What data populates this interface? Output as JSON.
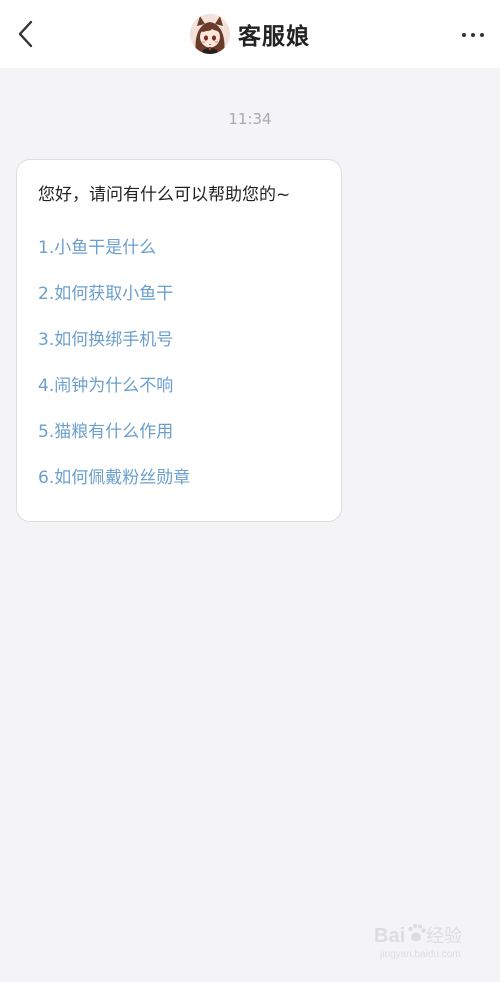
{
  "header": {
    "title": "客服娘",
    "back_icon": "chevron-left-icon",
    "more_icon": "more-horizontal-icon",
    "avatar": "avatar-anime-girl"
  },
  "chat": {
    "timestamp": "11:34",
    "message": {
      "greeting": "您好，请问有什么可以帮助您的~",
      "options": [
        "1.小鱼干是什么",
        "2.如何获取小鱼干",
        "3.如何换绑手机号",
        "4.闹钟为什么不响",
        "5.猫粮有什么作用",
        "6.如何佩戴粉丝勋章"
      ]
    }
  },
  "watermark": {
    "brand": "Baidu经验",
    "url": "jingyan.baidu.com"
  },
  "colors": {
    "background": "#f4f4f6",
    "header_bg": "#ffffff",
    "bubble_bg": "#ffffff",
    "bubble_border": "#dedede",
    "link": "#6b9fce",
    "text": "#222222",
    "timestamp": "#a9a9a9"
  }
}
